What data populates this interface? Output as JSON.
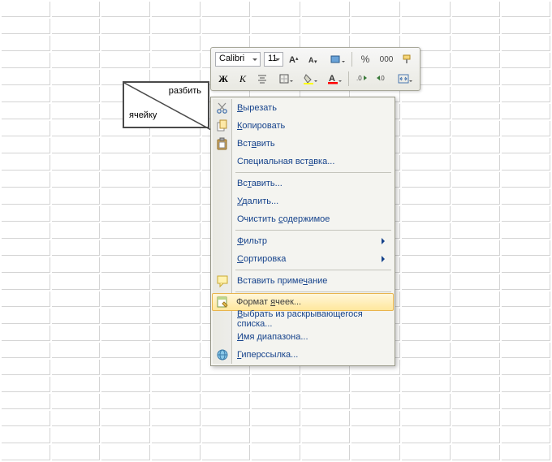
{
  "split_cell": {
    "top_text": "разбить",
    "bottom_text": "ячейку"
  },
  "mini_toolbar": {
    "font_name": "Calibri",
    "font_size": "11",
    "percent": "%",
    "thousands": "000"
  },
  "context_menu": {
    "items": [
      {
        "label_pre": "",
        "u": "В",
        "label_post": "ырезать",
        "icon": "cut",
        "submenu": false
      },
      {
        "label_pre": "",
        "u": "К",
        "label_post": "опировать",
        "icon": "copy",
        "submenu": false
      },
      {
        "label_pre": "Вст",
        "u": "а",
        "label_post": "вить",
        "icon": "paste",
        "submenu": false
      },
      {
        "label_pre": "Специальная вст",
        "u": "а",
        "label_post": "вка...",
        "icon": "",
        "submenu": false
      },
      {
        "separator": true
      },
      {
        "label_pre": "Вс",
        "u": "т",
        "label_post": "авить...",
        "icon": "",
        "submenu": false
      },
      {
        "label_pre": "",
        "u": "У",
        "label_post": "далить...",
        "icon": "",
        "submenu": false
      },
      {
        "label_pre": "Очистить ",
        "u": "с",
        "label_post": "одержимое",
        "icon": "",
        "submenu": false
      },
      {
        "separator": true
      },
      {
        "label_pre": "",
        "u": "Ф",
        "label_post": "ильтр",
        "icon": "",
        "submenu": true
      },
      {
        "label_pre": "",
        "u": "С",
        "label_post": "ортировка",
        "icon": "",
        "submenu": true
      },
      {
        "separator": true
      },
      {
        "label_pre": "Вставить приме",
        "u": "ч",
        "label_post": "ание",
        "icon": "comment",
        "submenu": false
      },
      {
        "separator": true
      },
      {
        "label_pre": "Формат ",
        "u": "я",
        "label_post": "чеек...",
        "icon": "format",
        "submenu": false,
        "selected": true
      },
      {
        "label_pre": "",
        "u": "В",
        "label_post": "ыбрать из раскрывающегося списка...",
        "icon": "",
        "submenu": false
      },
      {
        "label_pre": "",
        "u": "И",
        "label_post": "мя диапазона...",
        "icon": "",
        "submenu": false
      },
      {
        "label_pre": "",
        "u": "Г",
        "label_post": "иперссылка...",
        "icon": "hyperlink",
        "submenu": false
      }
    ]
  }
}
